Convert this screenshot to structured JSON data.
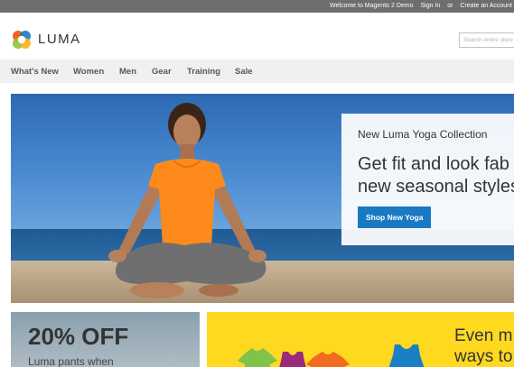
{
  "topbar": {
    "welcome": "Welcome to Magento 2 Demo",
    "sign_in": "Sign In",
    "or": "or",
    "create_account": "Create an Account"
  },
  "header": {
    "logo_text": "LUMA",
    "search_placeholder": "Search entire store here..."
  },
  "nav": {
    "items": [
      "What's New",
      "Women",
      "Men",
      "Gear",
      "Training",
      "Sale"
    ]
  },
  "hero": {
    "subtitle": "New Luma Yoga Collection",
    "headline_line1": "Get fit and look fab",
    "headline_line2": "new seasonal styles",
    "cta": "Shop New Yoga"
  },
  "promo_left": {
    "headline": "20% OFF",
    "sub": "Luma pants when"
  },
  "promo_right": {
    "line1": "Even m",
    "line2": "ways to"
  },
  "colors": {
    "accent": "#1979c3",
    "topbar": "#6e6e6e",
    "promo_yellow": "#ffd91f"
  }
}
